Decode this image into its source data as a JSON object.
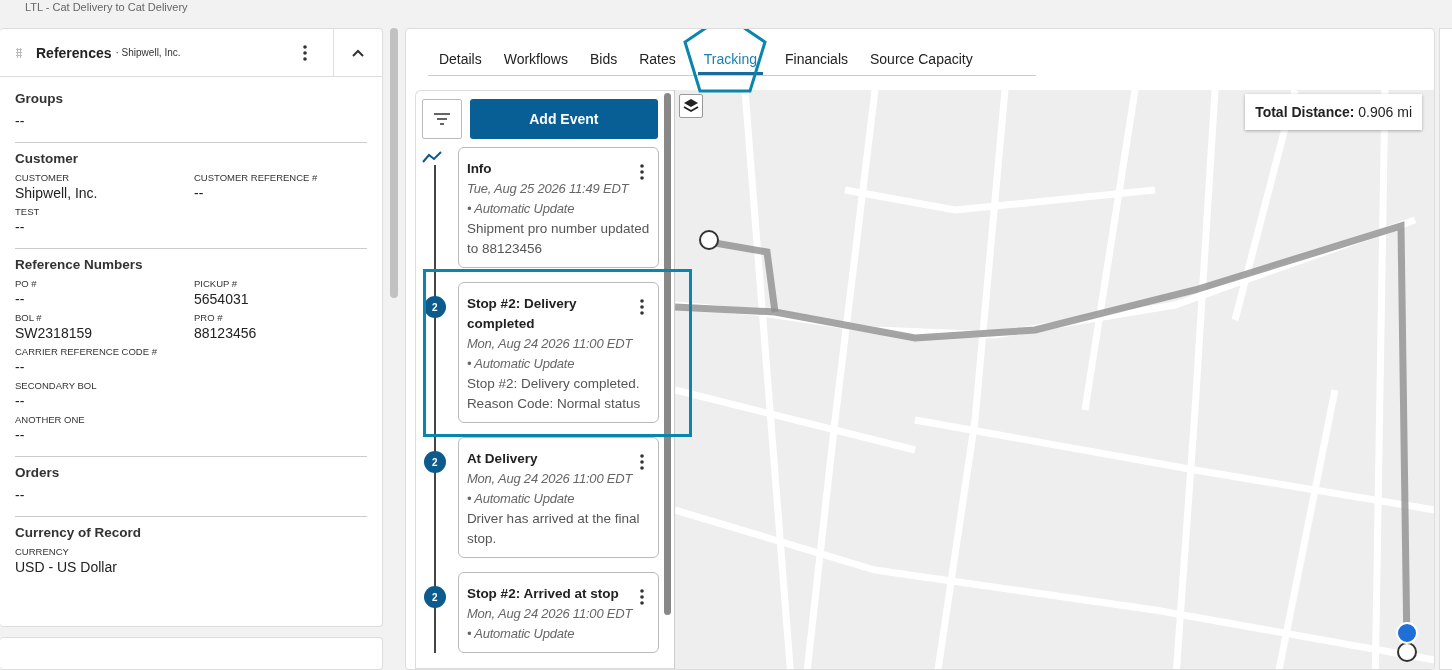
{
  "breadcrumb": "LTL - Cat Delivery to Cat Delivery",
  "references_panel": {
    "title": "References",
    "subtitle": "· Shipwell, Inc.",
    "expanded": true,
    "sections": [
      {
        "title": "Groups",
        "rows": [
          [
            {
              "value": "--"
            }
          ]
        ]
      },
      {
        "title": "Customer",
        "rows": [
          [
            {
              "label": "CUSTOMER",
              "value": "Shipwell, Inc."
            },
            {
              "label": "CUSTOMER REFERENCE #",
              "value": "--"
            }
          ],
          [
            {
              "label": "TEST",
              "value": "--"
            }
          ]
        ]
      },
      {
        "title": "Reference Numbers",
        "rows": [
          [
            {
              "label": "PO #",
              "value": "--"
            },
            {
              "label": "PICKUP #",
              "value": "5654031"
            }
          ],
          [
            {
              "label": "BOL #",
              "value": "SW2318159"
            },
            {
              "label": "PRO #",
              "value": "88123456"
            }
          ],
          [
            {
              "label": "CARRIER REFERENCE CODE #",
              "value": "--"
            }
          ],
          [
            {
              "label": "SECONDARY BOL",
              "value": "--"
            }
          ],
          [
            {
              "label": "ANOTHER ONE",
              "value": "--"
            }
          ]
        ]
      },
      {
        "title": "Orders",
        "rows": [
          [
            {
              "value": "--"
            }
          ]
        ]
      },
      {
        "title": "Currency of Record",
        "rows": [
          [
            {
              "label": "CURRENCY",
              "value": "USD - US Dollar"
            }
          ]
        ]
      }
    ]
  },
  "tabs": [
    {
      "label": "Details",
      "selected": false,
      "highlighted": false
    },
    {
      "label": "Workflows",
      "selected": false,
      "highlighted": false
    },
    {
      "label": "Bids",
      "selected": false,
      "highlighted": false
    },
    {
      "label": "Rates",
      "selected": false,
      "highlighted": false
    },
    {
      "label": "Tracking",
      "selected": true,
      "highlighted": true
    },
    {
      "label": "Financials",
      "selected": false,
      "highlighted": false
    },
    {
      "label": "Source Capacity",
      "selected": false,
      "highlighted": false
    }
  ],
  "timeline": {
    "add_button": "Add Event",
    "events": [
      {
        "kind": "info",
        "title": "Info",
        "date": "Tue, Aug 25 2026 11:49 EDT",
        "source": "• Automatic Update",
        "message": "Shipment pro number updated to 88123456",
        "highlighted": false
      },
      {
        "kind": "stop",
        "badge": "2",
        "title": "Stop #2: Delivery completed",
        "date": "Mon, Aug 24 2026 11:00 EDT",
        "source": "• Automatic Update",
        "message": "Stop #2: Delivery completed. Reason Code: Normal status",
        "highlighted": true
      },
      {
        "kind": "stop",
        "badge": "2",
        "title": "At Delivery",
        "date": "Mon, Aug 24 2026 11:00 EDT",
        "source": "• Automatic Update",
        "message": "Driver has arrived at the final stop.",
        "highlighted": false
      },
      {
        "kind": "stop",
        "badge": "2",
        "title": "Stop #2: Arrived at stop",
        "date": "Mon, Aug 24 2026 11:00 EDT",
        "source": "• Automatic Update",
        "highlighted": false
      }
    ]
  },
  "map": {
    "distance_label": "Total Distance:",
    "distance_value": "0.906 mi"
  }
}
